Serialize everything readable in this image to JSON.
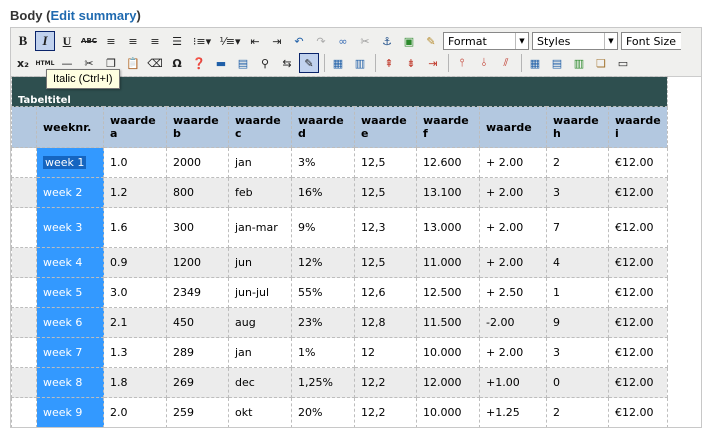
{
  "header": {
    "label": "Body",
    "link_label": "Edit summary"
  },
  "toolbar": {
    "format_label": "Format",
    "styles_label": "Styles",
    "fontsize_label": "Font Size",
    "bold_glyph": "B",
    "italic_glyph": "I",
    "underline_glyph": "U",
    "strike_glyph": "ABC",
    "html_glyph": "HTML",
    "tooltip": "Italic (Ctrl+I)"
  },
  "table": {
    "caption": "Tabeltitel",
    "headers": [
      "",
      "weeknr.",
      "waarde a",
      "waarde b",
      "waarde c",
      "waarde d",
      "waarde e",
      "waarde f",
      "waarde",
      "waarde h",
      "waarde i"
    ],
    "rows": [
      [
        "",
        "week 1",
        "1.0",
        "2000",
        "jan",
        "3%",
        "12,5",
        "12.600",
        "+ 2.00",
        "2",
        "€12.00"
      ],
      [
        "",
        "week 2",
        "1.2",
        "800",
        "feb",
        "16%",
        "12,5",
        "13.100",
        "+ 2.00",
        "3",
        "€12.00"
      ],
      [
        "",
        "week 3",
        "1.6",
        "300",
        "jan-mar",
        "9%",
        "12,3",
        "13.000",
        "+ 2.00",
        "7",
        "€12.00"
      ],
      [
        "",
        "week 4",
        "0.9",
        "1200",
        "jun",
        "12%",
        "12,5",
        "11.000",
        "+ 2.00",
        "4",
        "€12.00"
      ],
      [
        "",
        "week 5",
        "3.0",
        "2349",
        "jun-jul",
        "55%",
        "12,6",
        "12.500",
        "+ 2.50",
        "1",
        "€12.00"
      ],
      [
        "",
        "week 6",
        "2.1",
        "450",
        "aug",
        "23%",
        "12,8",
        "11.500",
        "-2.00",
        "9",
        "€12.00"
      ],
      [
        "",
        "week 7",
        "1.3",
        "289",
        "jan",
        "1%",
        "12",
        "10.000",
        "+ 2.00",
        "3",
        "€12.00"
      ],
      [
        "",
        "week 8",
        "1.8",
        "269",
        "dec",
        "1,25%",
        "12,2",
        "12.000",
        "+1.00",
        "0",
        "€12.00"
      ],
      [
        "",
        "week 9",
        "2.0",
        "259",
        "okt",
        "20%",
        "12,2",
        "10.000",
        "+1.25",
        "2",
        "€12.00"
      ]
    ]
  }
}
